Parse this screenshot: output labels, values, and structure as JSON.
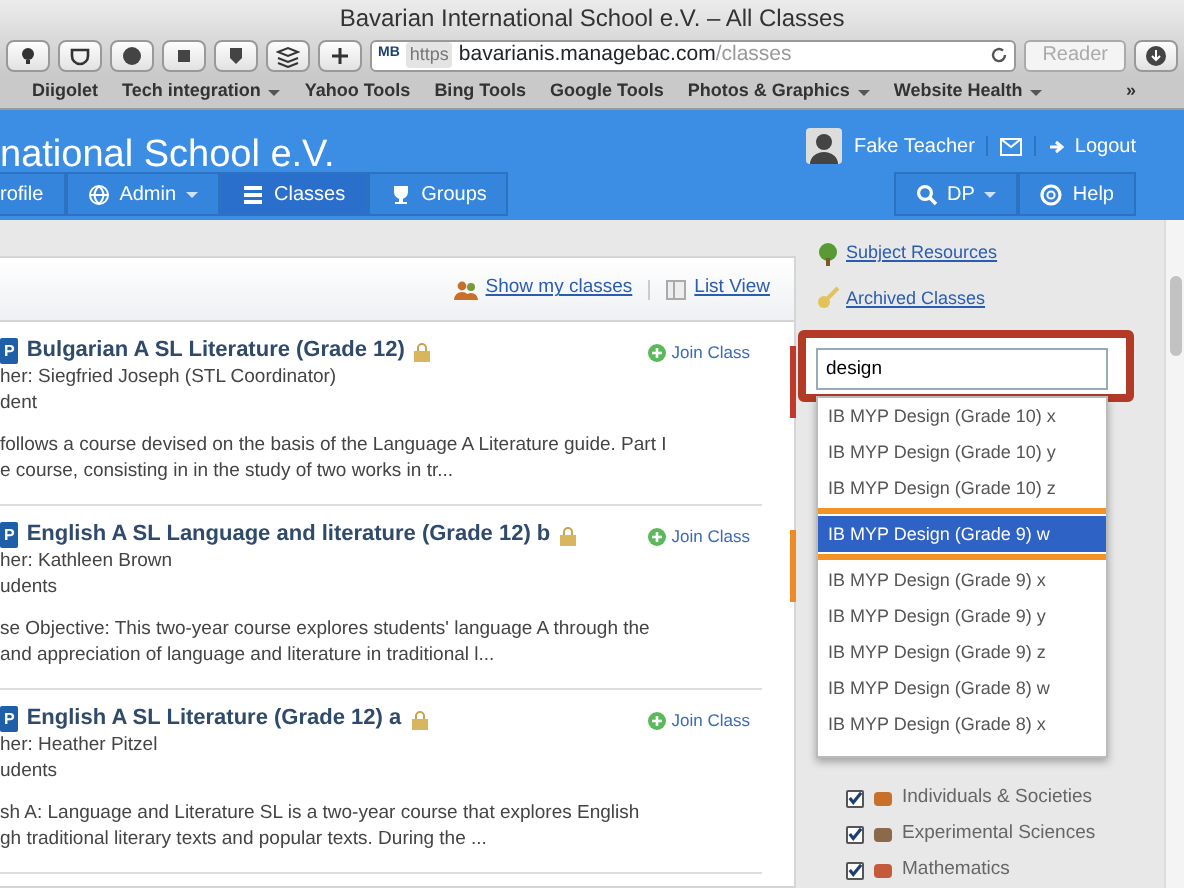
{
  "browser": {
    "title": "Bavarian International School e.V. – All Classes",
    "url_badge": "MB",
    "url_scheme": "https",
    "url_host": "bavarianis.managebac.com",
    "url_path": "/classes",
    "reader_button": "Reader",
    "overflow": "»",
    "bookmarks": [
      {
        "label": "Diigolet",
        "has_menu": false
      },
      {
        "label": "Tech integration",
        "has_menu": true
      },
      {
        "label": "Yahoo Tools",
        "has_menu": false
      },
      {
        "label": "Bing Tools",
        "has_menu": false
      },
      {
        "label": "Google Tools",
        "has_menu": false
      },
      {
        "label": "Photos & Graphics",
        "has_menu": true
      },
      {
        "label": "Website Health",
        "has_menu": true
      }
    ]
  },
  "header": {
    "school_name": "national School e.V.",
    "user_name": "Fake Teacher",
    "logout": "Logout"
  },
  "nav": {
    "left": [
      {
        "label": "rofile",
        "has_menu": false,
        "selected": false
      },
      {
        "label": "Admin",
        "has_menu": true,
        "selected": false
      },
      {
        "label": "Classes",
        "has_menu": false,
        "selected": true
      },
      {
        "label": "Groups",
        "has_menu": false,
        "selected": false
      }
    ],
    "right": [
      {
        "label": "DP",
        "has_menu": true
      },
      {
        "label": "Help",
        "has_menu": false
      }
    ]
  },
  "toolbar": {
    "show_mine": "Show my classes",
    "list_view": "List View"
  },
  "classes": [
    {
      "badge": "P",
      "title": "Bulgarian A SL Literature (Grade 12)",
      "teacher": "her: Siegfried Joseph (STL Coordinator)",
      "students": "dent",
      "join": "Join Class",
      "color": "#c0392b",
      "description": [
        "follows a course devised on the basis of the Language A Literature guide. Part I",
        "e course, consisting in in the study of two works in tr..."
      ]
    },
    {
      "badge": "P",
      "title": "English A SL Language and literature (Grade 12) b",
      "teacher": "her: Kathleen Brown",
      "students": "udents",
      "join": "Join Class",
      "color": "#f08a24",
      "description": [
        "se Objective: This two-year course explores students' language A through the",
        "and appreciation of language and literature in traditional l..."
      ]
    },
    {
      "badge": "P",
      "title": "English A SL Literature (Grade 12) a",
      "teacher": "her: Heather Pitzel",
      "students": "udents",
      "join": "Join Class",
      "description": [
        "sh A: Language and Literature SL is a two-year course that explores English",
        "gh traditional literary texts and popular texts. During the ..."
      ]
    }
  ],
  "sidebar": {
    "links": [
      "Subject Resources",
      "Archived Classes"
    ],
    "search": {
      "value": "design"
    },
    "suggestions": [
      {
        "label": "IB MYP Design (Grade 10) x",
        "selected": false
      },
      {
        "label": "IB MYP Design (Grade 10) y",
        "selected": false
      },
      {
        "label": "IB MYP Design (Grade 10) z",
        "selected": false
      },
      {
        "label": "IB MYP Design (Grade 9) w",
        "selected": true
      },
      {
        "label": "IB MYP Design (Grade 9) x",
        "selected": false
      },
      {
        "label": "IB MYP Design (Grade 9) y",
        "selected": false
      },
      {
        "label": "IB MYP Design (Grade 9) z",
        "selected": false
      },
      {
        "label": "IB MYP Design (Grade 8) w",
        "selected": false
      },
      {
        "label": "IB MYP Design (Grade 8) x",
        "selected": false
      }
    ],
    "subjects": [
      {
        "label": "Individuals & Societies",
        "checked": true
      },
      {
        "label": "Experimental Sciences",
        "checked": true
      },
      {
        "label": "Mathematics",
        "checked": true
      }
    ]
  }
}
